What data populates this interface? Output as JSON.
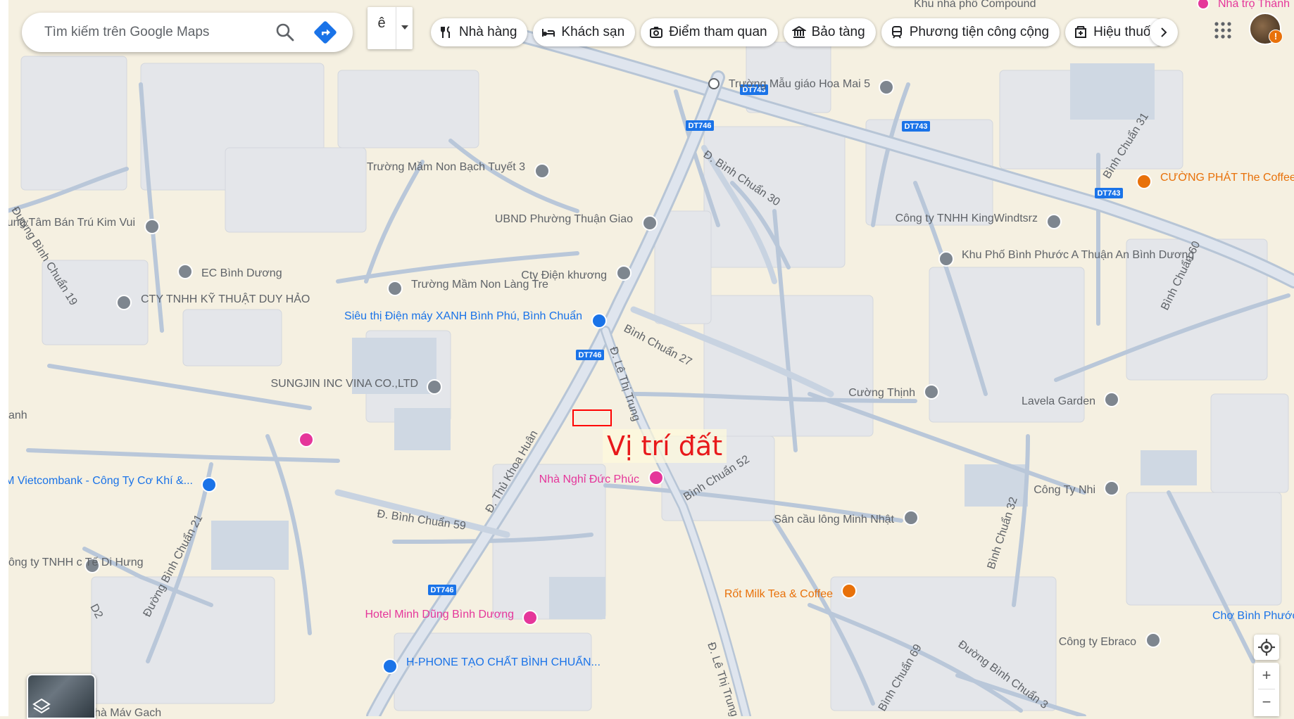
{
  "search": {
    "placeholder": "Tìm kiếm trên Google Maps"
  },
  "ime": {
    "letter": "ê"
  },
  "categories": [
    {
      "label": "Nhà hàng",
      "icon": "restaurant-icon"
    },
    {
      "label": "Khách sạn",
      "icon": "hotel-icon"
    },
    {
      "label": "Điểm tham quan",
      "icon": "camera-icon"
    },
    {
      "label": "Bảo tàng",
      "icon": "museum-icon"
    },
    {
      "label": "Phương tiện công cộng",
      "icon": "transit-icon"
    },
    {
      "label": "Hiệu thuốc",
      "icon": "pharmacy-icon"
    }
  ],
  "annotation": {
    "label": "Vị trí đất",
    "color": "#ff0000"
  },
  "road_shields": [
    "DT743",
    "DT746"
  ],
  "streets": [
    "Đường Bình Chuẩn 19",
    "Đường Bình Chuẩn 21",
    "Đ. Bình Chuẩn 59",
    "Đ. Thủ Khoa Huân",
    "Đ. Lê Thị Trung",
    "Bình Chuẩn 27",
    "Đ. Bình Chuẩn 30",
    "Bình Chuẩn 52",
    "Bình Chuẩn 32",
    "Bình Chuẩn 31",
    "Bình Chuẩn 60",
    "Bình Chuẩn 69",
    "Đường Bình Chuẩn 3",
    "D2"
  ],
  "places": [
    {
      "name": "Trường Mầm Non Bạch Tuyết 3",
      "icon": "school-icon",
      "color": "#5f6368"
    },
    {
      "name": "UBND Phường Thuận Giao",
      "icon": "government-icon",
      "color": "#5f6368"
    },
    {
      "name": "Trung Tâm Bán Trú Kim Vui",
      "icon": "school-icon",
      "color": "#5f6368"
    },
    {
      "name": "EC Bình Dương",
      "icon": "pin-icon",
      "color": "#5f6368"
    },
    {
      "name": "CTY TNHH KỸ THUẬT DUY HẢO",
      "icon": "building-icon",
      "color": "#5f6368"
    },
    {
      "name": "Trường Mầm Non Làng Tre",
      "icon": "school-icon",
      "color": "#5f6368"
    },
    {
      "name": "Cty Điện khương",
      "icon": "pin-icon",
      "color": "#5f6368"
    },
    {
      "name": "Siêu thị Điện máy XANH Bình Phú, Bình Chuẩn",
      "icon": "shopping-icon",
      "color": "#1a73e8"
    },
    {
      "name": "SUNGJIN INC VINA CO.,LTD",
      "icon": "pin-icon",
      "color": "#5f6368"
    },
    {
      "name": "ATM Vietcombank - Công Ty Cơ Khí &...",
      "icon": "bank-icon",
      "color": "#1a73e8"
    },
    {
      "name": "Nhà Nghỉ Đức Phúc",
      "icon": "hotel-icon",
      "color": "#e5369a"
    },
    {
      "name": "Hotel Minh Dũng Bình Dương",
      "icon": "hotel-icon",
      "color": "#e5369a"
    },
    {
      "name": "H-PHONE TẠO CHẤT BÌNH CHUẨN...",
      "icon": "shopping-icon",
      "color": "#1a73e8"
    },
    {
      "name": "Trường Mẫu giáo Hoa Mai 5",
      "icon": "school-icon",
      "color": "#5f6368"
    },
    {
      "name": "CƯỜNG PHÁT The Coffee",
      "icon": "cafe-icon",
      "color": "#e8710a"
    },
    {
      "name": "Công ty TNHH KingWindtsrz",
      "icon": "pin-icon",
      "color": "#5f6368"
    },
    {
      "name": "Khu Phố Bình Phước A Thuận An Bình Dương",
      "icon": "pin-icon",
      "color": "#5f6368"
    },
    {
      "name": "Cường Thịnh",
      "icon": "pin-icon",
      "color": "#5f6368"
    },
    {
      "name": "Lavela Garden",
      "icon": "pin-icon",
      "color": "#5f6368"
    },
    {
      "name": "Công Ty Nhi",
      "icon": "pin-icon",
      "color": "#5f6368"
    },
    {
      "name": "Sân cầu lông Minh Nhật",
      "icon": "pin-icon",
      "color": "#5f6368"
    },
    {
      "name": "Rốt Milk Tea & Coffee",
      "icon": "cafe-icon",
      "color": "#e8710a"
    },
    {
      "name": "Công ty Ebraco",
      "icon": "pin-icon",
      "color": "#5f6368"
    },
    {
      "name": "Chợ Bình Phước",
      "icon": "pin-icon",
      "color": "#1a73e8"
    },
    {
      "name": "Khu nhà phố Compound",
      "icon": "pin-icon",
      "color": "#5f6368"
    },
    {
      "name": "Nhà trọ Thành",
      "icon": "hotel-icon",
      "color": "#e5369a"
    },
    {
      "name": "ông ty TNHH c Tế Di Hưng",
      "icon": "pin-icon",
      "color": "#5f6368"
    },
    {
      "name": "hà Máy Gạch",
      "icon": "pin-icon",
      "color": "#5f6368"
    },
    {
      "name": "anh",
      "icon": "pin-icon",
      "color": "#5f6368"
    }
  ]
}
